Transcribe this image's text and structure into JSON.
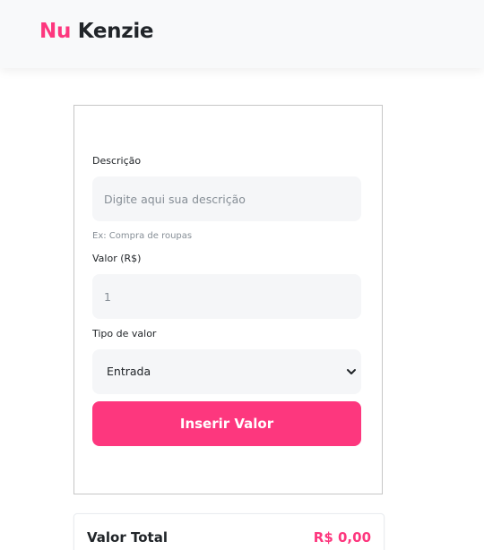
{
  "header": {
    "logo_nu": "Nu",
    "logo_kenzie": "Kenzie"
  },
  "form": {
    "description_label": "Descrição",
    "description_placeholder": "Digite aqui sua descrição",
    "description_value": "",
    "description_hint": "Ex: Compra de roupas",
    "value_label": "Valor (R$)",
    "value_placeholder": "1",
    "value_value": "",
    "type_label": "Tipo de valor",
    "type_selected": "Entrada",
    "submit_label": "Inserir Valor"
  },
  "total": {
    "label": "Valor Total",
    "value": "R$ 0,00"
  },
  "colors": {
    "accent": "#fd377e",
    "text": "#212529",
    "muted": "#868e96",
    "field_bg": "#f5f6f8",
    "header_bg": "#f8f9fa"
  },
  "icons": {
    "select_arrow": "chevron-down-icon"
  }
}
